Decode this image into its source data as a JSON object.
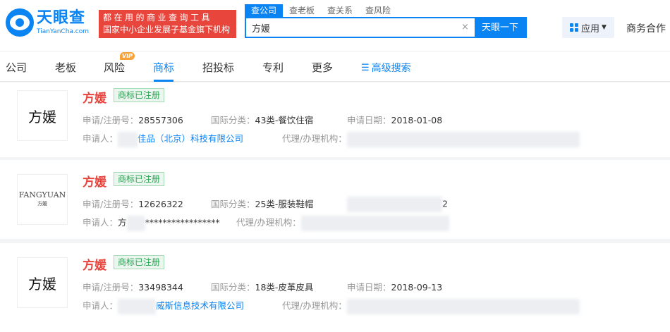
{
  "brand": {
    "name_cn": "天眼查",
    "name_en": "TianYanCha.com"
  },
  "slogan": {
    "line1": "都在用的商业查询工具",
    "line2": "国家中小企业发展子基金旗下机构"
  },
  "search": {
    "tabs": [
      "查公司",
      "查老板",
      "查关系",
      "查风险"
    ],
    "active_tab": "查公司",
    "value": "方媛",
    "clear": "×",
    "button": "天眼一下"
  },
  "header_right": {
    "apps": "应用",
    "business": "商务合作"
  },
  "nav": {
    "items": [
      "公司",
      "老板",
      "风险",
      "商标",
      "招投标",
      "专利",
      "更多"
    ],
    "active": "商标",
    "vip_badge": "VIP",
    "advanced_search": "高级搜索"
  },
  "labels": {
    "reg_no": "申请/注册号：",
    "intl_class": "国际分类：",
    "apply_date": "申请日期：",
    "applicant": "申请人：",
    "agency": "代理/办理机构："
  },
  "results": [
    {
      "logo_text": "方媛",
      "name": "方媛",
      "status": "商标已注册",
      "reg_no": "28557306",
      "intl_class": "43类-餐饮住宿",
      "apply_date": "2018-01-08",
      "applicant_visible": "佳品（北京）科技有限公司"
    },
    {
      "logo_text": "FANGYUAN",
      "logo_sub": "方媛",
      "name": "方媛",
      "status": "商标已注册",
      "reg_no": "12626322",
      "intl_class": "25类-服装鞋帽",
      "apply_date_partial": "2",
      "applicant_prefix": "方",
      "applicant_masked": "*****************"
    },
    {
      "logo_text": "方媛",
      "name": "方媛",
      "status": "商标已注册",
      "reg_no": "33498344",
      "intl_class": "18类-皮革皮具",
      "apply_date": "2018-09-13",
      "applicant_visible": "威斯信息技术有限公司"
    }
  ],
  "colors": {
    "brand_blue": "#0a83f3",
    "brand_red": "#e8453c",
    "status_green": "#22a44f",
    "vip_orange": "#f8a23a"
  }
}
